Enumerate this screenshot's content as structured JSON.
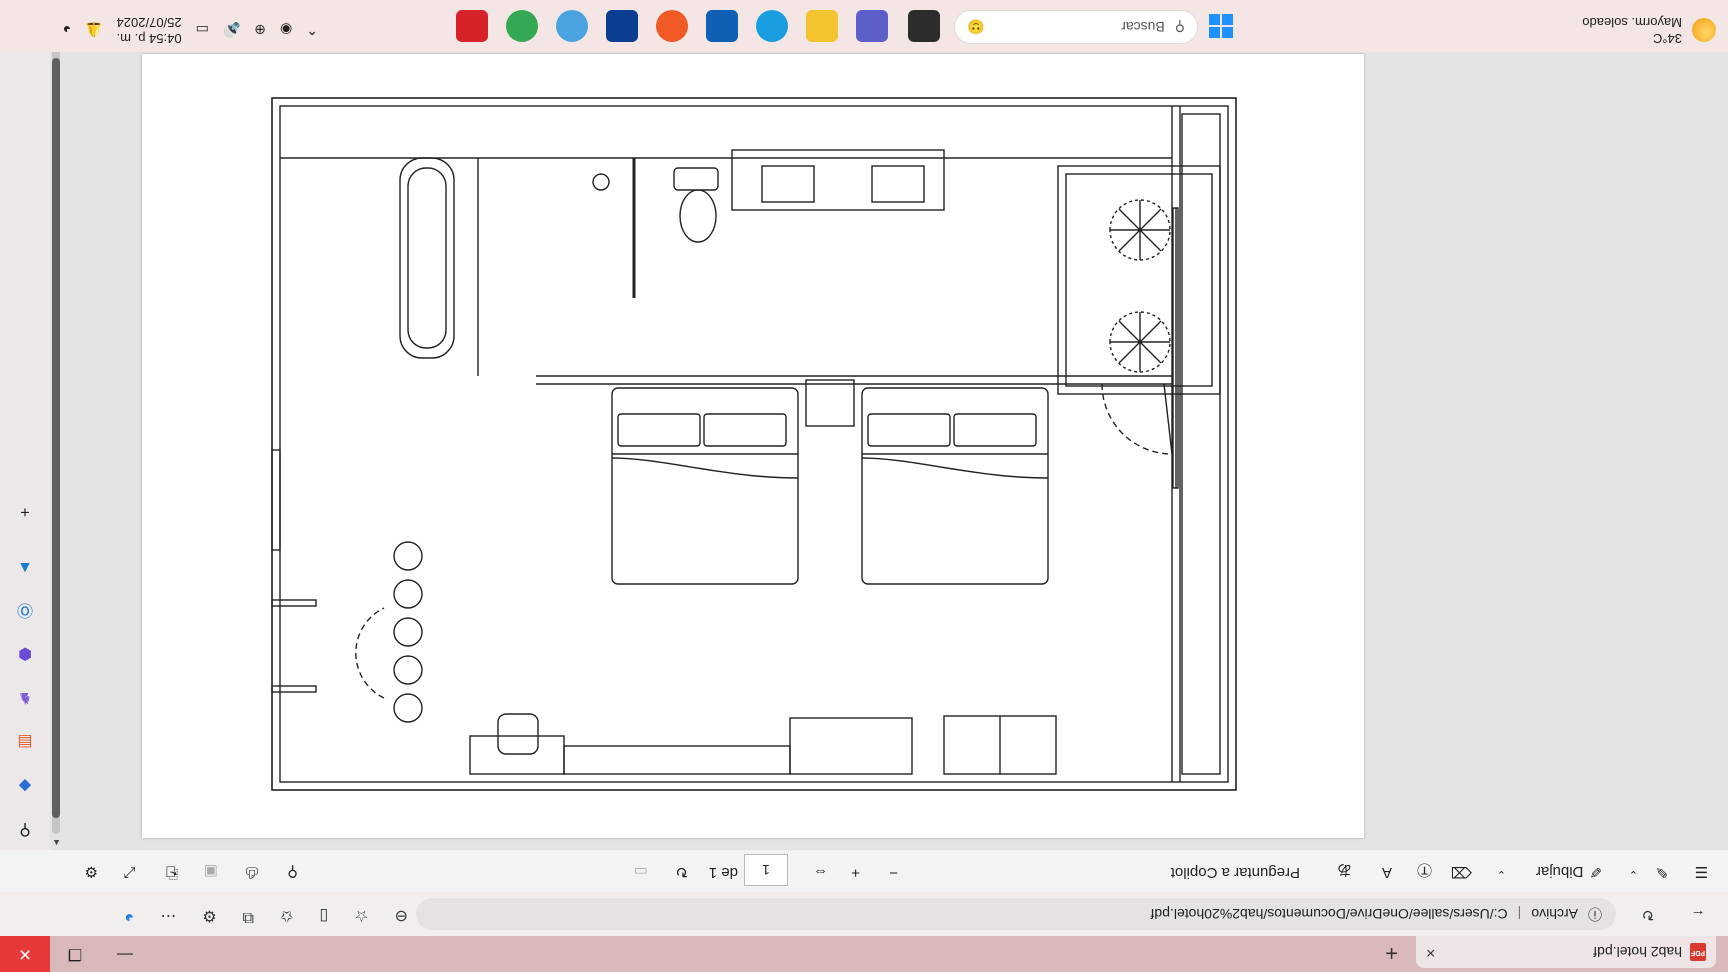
{
  "browser": {
    "tab_title": "hab2 hotel.pdf",
    "tab_close": "×",
    "new_tab": "+",
    "pdf_badge": "PDF"
  },
  "address": {
    "scheme_label": "Archivo",
    "separator": "|",
    "url": "C:/Users/sallee/OneDrive/Documentos/hab2%20hotel.pdf"
  },
  "pdf_toolbar": {
    "draw_label": "Dibujar",
    "copilot_label": "Preguntar a Copilot",
    "page_current": "1",
    "page_total": "de 1",
    "zoom_in": "+",
    "zoom_out": "−"
  },
  "taskbar": {
    "weather_temp": "34°C",
    "weather_desc": "Mayorm. soleado",
    "search_placeholder": "Buscar",
    "time": "04:54 p. m.",
    "date": "25/07/2024"
  },
  "colors": {
    "titlebar": "#d9b9bc",
    "close_button": "#e8393a",
    "scroll_thumb": "#5f5f63"
  }
}
